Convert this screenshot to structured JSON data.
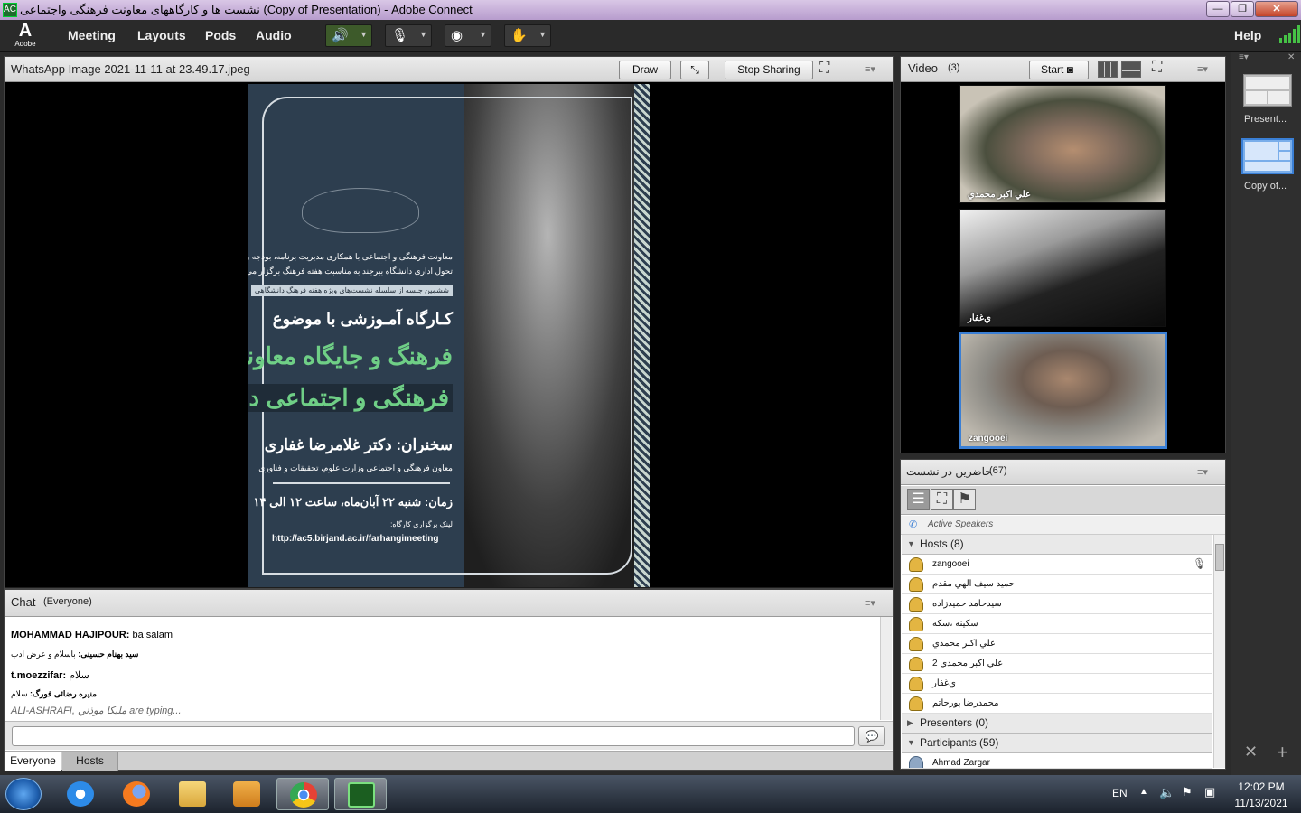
{
  "window": {
    "title": "نشست ها و کارگاههای معاونت فرهنگی واجتماعی (Copy of Presentation) - Adobe Connect",
    "buttons": [
      "—",
      "❐",
      "✕"
    ]
  },
  "menubar": {
    "logo_letter": "A",
    "logo_word": "Adobe",
    "items": [
      "Meeting",
      "Layouts",
      "Pods",
      "Audio"
    ],
    "help": "Help"
  },
  "share_pod": {
    "title": "WhatsApp Image 2021-11-11 at 23.49.17.jpeg",
    "draw_label": "Draw",
    "stop_sharing_label": "Stop Sharing",
    "poster": {
      "intro1": "معاونت فرهنگی و اجتماعی با همکاری مدیریت برنامه، بودجه و",
      "intro2": "تحول اداری دانشگاه بیرجند به مناسبت هفته فرهنگ برگزار می کند:",
      "series": "ششمین جلسه از سلسله نشست‌های ویژه هفته فرهنگ دانشگاهی",
      "workshop": "کـارگاه آمـوزشی با موضوع",
      "topic1": "فرهنگ و جایگاه معاونت",
      "topic2": "فرهنگی و اجتماعی در دانشگاه",
      "speaker": "سخنران: دکتر غلامرضا غفاری",
      "speaker_role": "معاون فرهنگی و اجتماعی وزارت علوم، تحقیقات و فناوری",
      "time": "زمان: شنبه ۲۲ آبان‌ماه، ساعت ۱۲ الی ۱۴",
      "link_label": "لینک برگزاری کارگاه:",
      "link": "http://ac5.birjand.ac.ir/farhangimeeting"
    }
  },
  "video_pod": {
    "title": "Video",
    "count": "(3)",
    "start_label": "Start",
    "feeds": [
      {
        "name": "علي اكبر محمدي"
      },
      {
        "name": "ي‌غفار"
      },
      {
        "name": "zangooei"
      }
    ]
  },
  "attendees_pod": {
    "title": "حاضرین در نشست",
    "count": "(67)",
    "active_speakers": "Active Speakers",
    "hosts_label": "Hosts (8)",
    "hosts": [
      "zangooei",
      "حميد سيف  الهي  مقدم",
      "سیدحامد حمیدزاده",
      "سکینه ،سکه",
      "علي اكبر محمدي",
      "علي اكبر محمدي 2",
      "ي‌غفار",
      "محمدرضا پورحاتم"
    ],
    "presenters_label": "Presenters (0)",
    "participants_label": "Participants (59)",
    "participants": [
      "Ahmad Zargar"
    ]
  },
  "chat_pod": {
    "title": "Chat",
    "scope": "(Everyone)",
    "messages": [
      {
        "sender": "MOHAMMAD HAJIPOUR:",
        "text": " ba salam"
      },
      {
        "sender": "سید بهنام حسینی:",
        "text": " باسلام و عرض ادب"
      },
      {
        "sender": "t.moezzifar:",
        "text": " سلام"
      },
      {
        "sender": "منیره رضائی فورگ:",
        "text": " سلام"
      }
    ],
    "typing": "ALI-ASHRAFI, مليكا موذني are typing...",
    "tabs": [
      "Everyone",
      "Hosts"
    ]
  },
  "right_panel": {
    "layouts": [
      "Present...",
      "Copy of..."
    ]
  },
  "taskbar": {
    "lang": "EN",
    "time": "12:02 PM",
    "date": "11/13/2021"
  },
  "colors": {
    "accent_blue": "#3a7fd5",
    "poster_green": "#6fcf86",
    "audio_green": "#46c246"
  }
}
